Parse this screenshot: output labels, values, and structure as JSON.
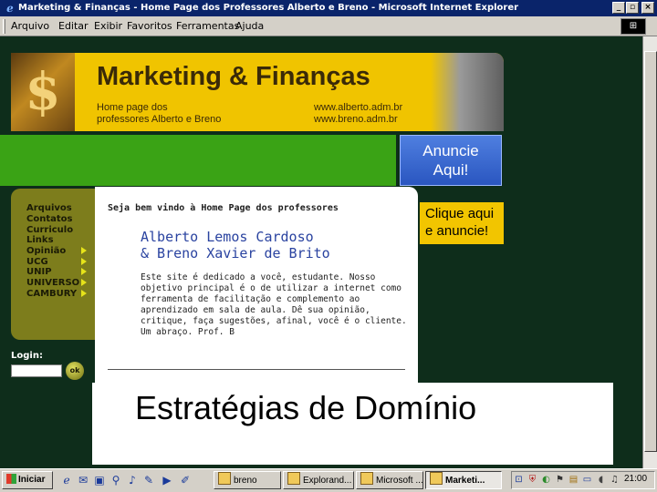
{
  "window": {
    "title": "Marketing & Finanças - Home Page dos Professores Alberto e Breno - Microsoft Internet Explorer",
    "controls": {
      "minimize": "_",
      "maximize": "▫",
      "close": "×"
    }
  },
  "menubar": {
    "items": [
      "Arquivo",
      "Editar",
      "Exibir",
      "Favoritos",
      "Ferramentas",
      "Ajuda"
    ]
  },
  "page": {
    "banner": {
      "brand": "Marketing & Finanças",
      "tagline_1": "Home page dos",
      "tagline_2": "professores Alberto e Breno",
      "url_1": "www.alberto.adm.br",
      "url_2": "www.breno.adm.br"
    },
    "ads": {
      "ad1_line1": "Anuncie",
      "ad1_line2": "Aqui!",
      "ad2_line1": "Clique aqui",
      "ad2_line2": "e anuncie!"
    },
    "sidebar": {
      "items": [
        "Arquivos",
        "Contatos",
        "Curriculo",
        "Links",
        "Opinião",
        "UCG",
        "UNIP",
        "UNIVERSO",
        "CAMBURY"
      ],
      "arrow_items": [
        "Opinião",
        "UCG",
        "UNIP",
        "UNIVERSO",
        "CAMBURY"
      ]
    },
    "login": {
      "label": "Login:",
      "value": "",
      "ok_label": "ok"
    },
    "main": {
      "welcome": "Seja bem vindo à Home Page dos professores",
      "name_1": "Alberto Lemos Cardoso",
      "name_2": "& Breno Xavier de Brito",
      "intro": "Este site é dedicado a você, estudante. Nosso objetivo principal é o de utilizar a internet como ferramenta de facilitação e complemento ao aprendizado em sala de aula. Dê sua opinião, critique, faça sugestões, afinal, você é o cliente. Um abraço. Prof. B"
    }
  },
  "overlay": {
    "caption": "Estratégias de Domínio"
  },
  "taskbar": {
    "start_label": "Iniciar",
    "quick_launch_icons": [
      "ie-icon",
      "outlook-icon",
      "desktop-icon",
      "search-icon",
      "media-icon",
      "pen-icon"
    ],
    "tasks": [
      {
        "label": "breno",
        "active": false
      },
      {
        "label": "Explorand...",
        "active": false
      },
      {
        "label": "Microsoft ...",
        "active": false
      },
      {
        "label": "Marketi...",
        "active": true
      }
    ],
    "clock": "21:00"
  },
  "colors": {
    "titlebar": "#0a246a",
    "page_background": "#0e2d1b",
    "banner_yellow": "#f0c400",
    "green_bar": "#3aa315",
    "sidebar_olive": "#7d7d1c",
    "ad_blue": "#2a56c0",
    "name_blue": "#2a43a0"
  }
}
